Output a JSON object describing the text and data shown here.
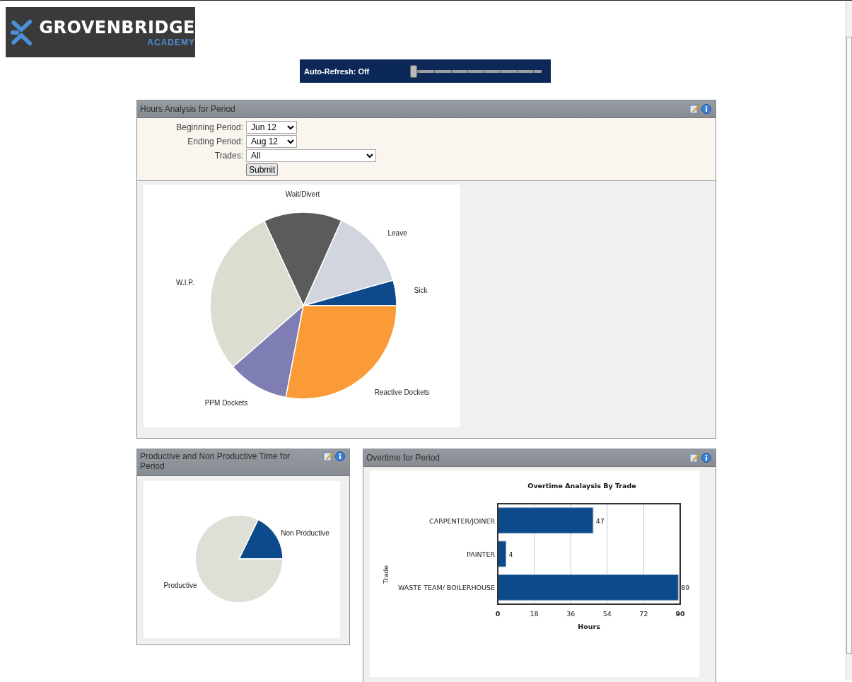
{
  "logo": {
    "name": "GROVENBRIDGE",
    "subtitle": "ACADEMY"
  },
  "auto_refresh": {
    "label": "Auto-Refresh: Off",
    "level": 0
  },
  "hours_panel": {
    "title": "Hours Analysis for Period",
    "form": [
      {
        "label": "Beginning Period:",
        "value": "Jun 12",
        "kind": "short"
      },
      {
        "label": "Ending Period:",
        "value": "Aug 12",
        "kind": "short"
      },
      {
        "label": "Trades:",
        "value": "All",
        "kind": "wide"
      }
    ],
    "submit": "Submit",
    "chart_data": {
      "type": "pie",
      "categories": [
        "Sick",
        "Leave",
        "Wait/Divert",
        "W.I.P.",
        "PPM Dockets",
        "Reactive Dockets"
      ],
      "series": [
        {
          "values": [
            4.4,
            13.9,
            13.6,
            29.5,
            10.6,
            28.0
          ]
        }
      ],
      "colors": [
        "#0c4a8c",
        "#d1d5dd",
        "#5b5b5b",
        "#dcdcd0",
        "#7e7db4",
        "#fb9b38"
      ]
    }
  },
  "productive_panel": {
    "title": "Productive and Non Productive Time for Period",
    "chart_data": {
      "type": "pie",
      "categories": [
        "Non Productive",
        "Productive"
      ],
      "series": [
        {
          "values": [
            17.8,
            82.2
          ]
        }
      ],
      "colors": [
        "#0c4a8c",
        "#dfdfd8"
      ]
    }
  },
  "overtime_panel": {
    "title": "Overtime for Period",
    "chart_data": {
      "type": "bar",
      "orientation": "horizontal",
      "title": "Overtime Analaysis By Trade",
      "xlabel": "Hours",
      "ylabel": "Trade",
      "categories": [
        "CARPENTER/JOINER",
        "PAINTER",
        "WASTE TEAM/ BOILERHOUSE"
      ],
      "series": [
        {
          "color": "#0c4a8c",
          "values": [
            47,
            4,
            89
          ]
        }
      ],
      "xlim": [
        0,
        90
      ],
      "xticks": [
        0,
        18,
        36,
        54,
        72,
        90
      ],
      "grid": true,
      "data_labels": true
    }
  }
}
